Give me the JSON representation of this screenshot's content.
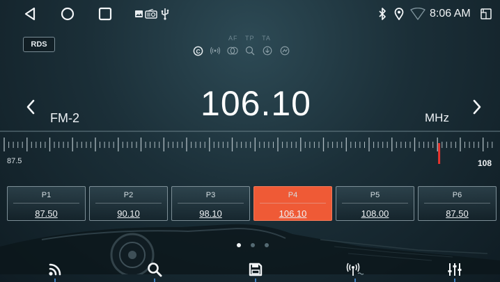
{
  "statusbar": {
    "left_icons": [
      "back-triangle-icon",
      "home-circle-icon",
      "recents-square-icon",
      "image-notification-icon",
      "radio-notification-icon",
      "usb-icon"
    ],
    "right_icons": [
      "bluetooth-icon",
      "location-icon",
      "wifi-icon",
      "screenshot-icon"
    ],
    "time": "8:06 AM"
  },
  "rds": {
    "label": "RDS"
  },
  "flags": [
    "AF",
    "TP",
    "TA"
  ],
  "mini_icons": [
    "stereo-icon",
    "signal-icon",
    "loudness-icon",
    "search-small-icon",
    "download-icon",
    "circle-arrow-icon"
  ],
  "tuner": {
    "band": "FM-2",
    "frequency": "106.10",
    "unit": "MHz",
    "scale_min": "87.5",
    "scale_max": "108",
    "needle_value": 106.1
  },
  "presets": [
    {
      "name": "P1",
      "freq": "87.50",
      "active": false
    },
    {
      "name": "P2",
      "freq": "90.10",
      "active": false
    },
    {
      "name": "P3",
      "freq": "98.10",
      "active": false
    },
    {
      "name": "P4",
      "freq": "106.10",
      "active": true
    },
    {
      "name": "P5",
      "freq": "108.00",
      "active": false
    },
    {
      "name": "P6",
      "freq": "87.50",
      "active": false
    }
  ],
  "page_dots": {
    "count": 3,
    "active": 0
  },
  "bottom_nav": [
    "broadcast-icon",
    "search-icon",
    "save-icon",
    "antenna-icon",
    "equalizer-icon"
  ],
  "colors": {
    "accent": "#ef5a36",
    "needle": "#e8342e"
  }
}
